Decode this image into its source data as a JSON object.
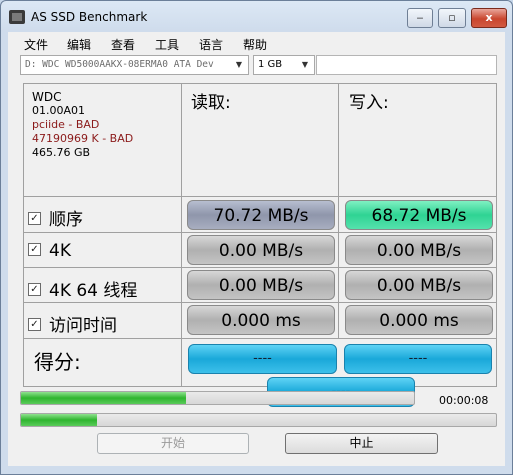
{
  "window": {
    "title": "AS SSD Benchmark",
    "minimize": "‒",
    "maximize": "▫",
    "close": "x"
  },
  "menu": [
    "文件",
    "编辑",
    "查看",
    "工具",
    "语言",
    "帮助"
  ],
  "drive_select": {
    "value": "D: WDC WD5000AAKX-08ERMA0 ATA Dev"
  },
  "size_select": {
    "value": "1 GB"
  },
  "drive_info": {
    "vendor": "WDC",
    "firmware": "01.00A01",
    "driver": "pciide - BAD",
    "offset": "47190969 K - BAD",
    "capacity": "465.76 GB"
  },
  "columns": {
    "read": "读取:",
    "write": "写入:"
  },
  "rows": [
    {
      "label": "顺序",
      "checked": true,
      "read": "70.72 MB/s",
      "write": "68.72 MB/s"
    },
    {
      "label": "4K",
      "checked": true,
      "read": "0.00 MB/s",
      "write": "0.00 MB/s"
    },
    {
      "label": "4K 64 线程",
      "checked": true,
      "read": "0.00 MB/s",
      "write": "0.00 MB/s"
    },
    {
      "label": "访问时间",
      "checked": true,
      "read": "0.000 ms",
      "write": "0.000 ms"
    }
  ],
  "score": {
    "label": "得分:",
    "read": "----",
    "write": "----",
    "total": "----"
  },
  "progress": {
    "total_fraction": 0.42,
    "current_fraction": 0.16,
    "elapsed": "00:00:08"
  },
  "buttons": {
    "start": "开始",
    "stop": "中止"
  },
  "colors": {
    "read_seq": "#9aa0b5",
    "write_seq": "#34d99a",
    "score": "#1aa8d9",
    "progress": "#2fb52f"
  }
}
